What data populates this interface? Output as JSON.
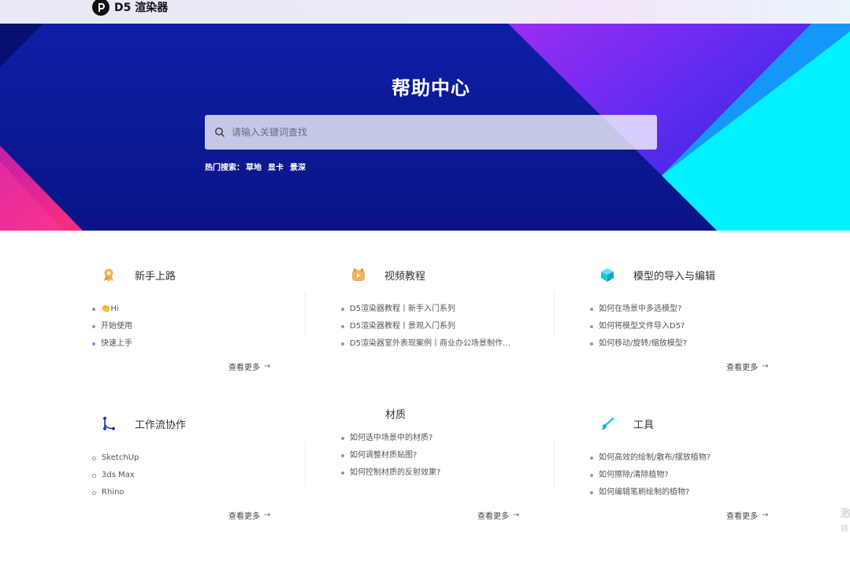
{
  "header": {
    "logo_text": "D5 渲染器"
  },
  "hero": {
    "title": "帮助中心",
    "search_placeholder": "请输入关键词查找",
    "hot_label": "热门搜索：",
    "hot_keywords": [
      "草地",
      "显卡",
      "景深"
    ]
  },
  "sections": [
    {
      "title": "新手上路",
      "icon": "award-icon",
      "items": [
        "👏Hi",
        "开始使用",
        "快速上手"
      ],
      "more": "查看更多"
    },
    {
      "title": "视频教程",
      "icon": "video-icon",
      "items": [
        "D5渲染器教程丨新手入门系列",
        "D5渲染器教程丨景观入门系列",
        "D5渲染器室外表现案例丨商业办公场景制作…"
      ],
      "more": ""
    },
    {
      "title": "模型的导入与编辑",
      "icon": "cube-icon",
      "items": [
        "如何在场景中多选模型?",
        "如何将模型文件导入D5?",
        "如何移动/旋转/缩放模型?"
      ],
      "more": "查看更多"
    },
    {
      "title": "工作流协作",
      "icon": "workflow-icon",
      "items": [
        "SketchUp",
        "3ds Max",
        "Rhino"
      ],
      "more": "查看更多"
    },
    {
      "title": "材质",
      "icon": "",
      "items": [
        "如何选中场景中的材质?",
        "如何调整材质贴图?",
        "如何控制材质的反射效果?"
      ],
      "more": "查看更多"
    },
    {
      "title": "工具",
      "icon": "brush-icon",
      "items": [
        "如何高效的绘制/散布/摆放植物?",
        "如何擦除/清除植物?",
        "如何编辑笔刷绘制的植物?"
      ],
      "more": "查看更多"
    }
  ],
  "watermark": {
    "line1": "激",
    "line2": "转"
  },
  "colors": {
    "hero_blue": "#0a1a8c",
    "accent_purple": "#8b2ff0",
    "accent_cyan": "#00f0ff",
    "accent_magenta": "#e0208c",
    "bullet": "#8f93c8"
  }
}
